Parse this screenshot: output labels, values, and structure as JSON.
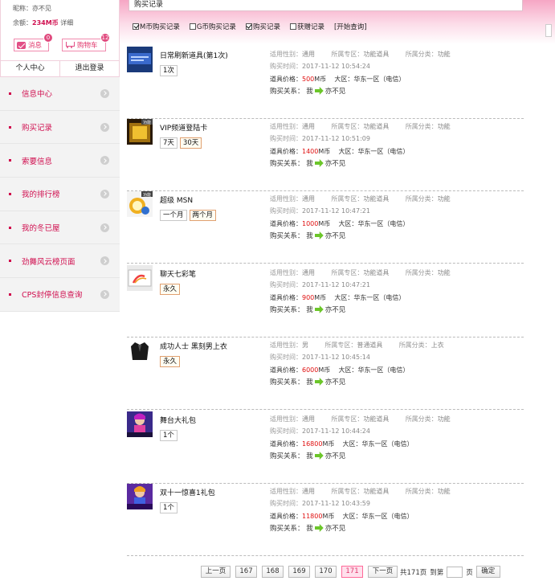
{
  "user": {
    "nickname_label": "昵称：",
    "nickname": "亦不见",
    "balance_label": "余额：",
    "balance": "234M币",
    "detail_link": "详细",
    "messages_label": "消息",
    "messages_count": "0",
    "cart_label": "购物车",
    "cart_count": "12",
    "tabs": [
      "个人中心",
      "退出登录"
    ]
  },
  "menu": [
    "信息中心",
    "购买记录",
    "索要信息",
    "我的排行榜",
    "我的冬已屋",
    "劲舞风云榜页面",
    "CPS封停信息查询"
  ],
  "page_title": "购买记录",
  "filters": [
    {
      "label": "M币购买记录",
      "checked": true
    },
    {
      "label": "G币购买记录",
      "checked": false
    },
    {
      "label": "购买记录",
      "checked": true
    },
    {
      "label": "获赠记录",
      "checked": false
    }
  ],
  "query_button": "[开始查询]",
  "labels": {
    "gender": "适用性别：",
    "zone": "所属专区：",
    "category": "所属分类：",
    "time": "购买时间：",
    "price": "道具价格：",
    "currency": "M币",
    "region": "大区：",
    "relation": "购买关系：",
    "me": "我"
  },
  "records": [
    {
      "name": "日常刷新道具(第1次)",
      "options": [
        "1次"
      ],
      "selected": 0,
      "gender": "通用",
      "zone": "功能道具",
      "category": "功能",
      "time": "2017-11-12 10:54:24",
      "price": "500",
      "region": "华东一区（电信）",
      "target": "亦不见",
      "thumb": "daily-refresh-icon"
    },
    {
      "name": "VIP频道登陆卡",
      "options": [
        "7天",
        "30天"
      ],
      "selected": 1,
      "gender": "通用",
      "zone": "功能道具",
      "category": "功能",
      "time": "2017-11-12 10:51:09",
      "price": "1400",
      "region": "华东一区（电信）",
      "target": "亦不见",
      "thumb": "vip-card-icon"
    },
    {
      "name": "超级 MSN",
      "options": [
        "一个月",
        "两个月"
      ],
      "selected": 1,
      "gender": "通用",
      "zone": "功能道具",
      "category": "功能",
      "time": "2017-11-12 10:47:21",
      "price": "1000",
      "region": "华东一区（电信）",
      "target": "亦不见",
      "thumb": "super-msn-icon"
    },
    {
      "name": "聊天七彩笔",
      "options": [
        "永久"
      ],
      "selected": 0,
      "gender": "通用",
      "zone": "功能道具",
      "category": "功能",
      "time": "2017-11-12 10:47:21",
      "price": "900",
      "region": "华东一区（电信）",
      "target": "亦不见",
      "thumb": "color-pen-icon"
    },
    {
      "name": "成功人士 黑刻男上衣",
      "options": [
        "永久"
      ],
      "selected": 0,
      "gender": "男",
      "zone": "普通道具",
      "category": "上衣",
      "time": "2017-11-12 10:45:14",
      "price": "6000",
      "region": "华东一区（电信）",
      "target": "亦不见",
      "thumb": "black-jacket-icon"
    },
    {
      "name": "舞台大礼包",
      "options": [
        "1个"
      ],
      "selected": -1,
      "gender": "通用",
      "zone": "功能道具",
      "category": "功能",
      "time": "2017-11-12 10:44:24",
      "price": "16800",
      "region": "华东一区（电信）",
      "target": "亦不见",
      "thumb": "stage-gift-icon"
    },
    {
      "name": "双十一惊喜1礼包",
      "options": [
        "1个"
      ],
      "selected": -1,
      "gender": "通用",
      "zone": "功能道具",
      "category": "功能",
      "time": "2017-11-12 10:43:59",
      "price": "11800",
      "region": "华东一区（电信）",
      "target": "亦不见",
      "thumb": "double11-gift-icon"
    }
  ],
  "pagination": {
    "prev": "上一页",
    "pages": [
      "167",
      "168",
      "169",
      "170",
      "171"
    ],
    "current": "171",
    "next": "下一页",
    "total": "共171页",
    "goto_label": "到第",
    "page_unit": "页",
    "confirm": "确定"
  }
}
